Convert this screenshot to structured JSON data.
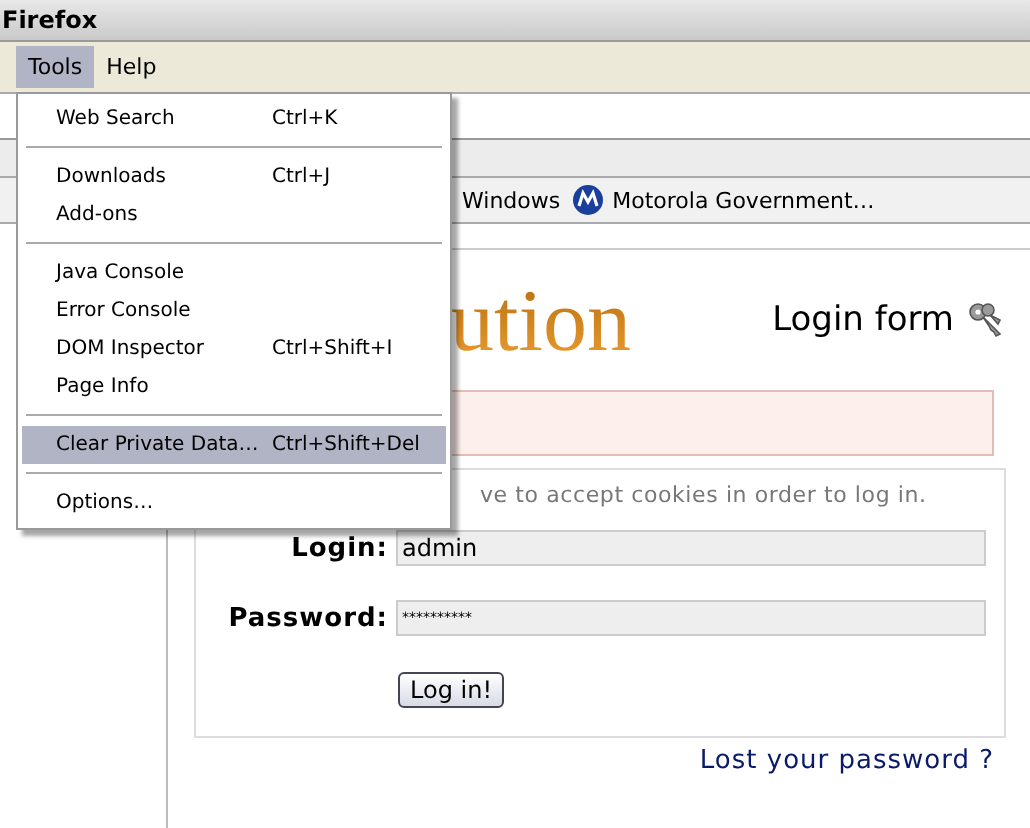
{
  "window": {
    "title": "Firefox"
  },
  "menubar": [
    {
      "label": "Tools",
      "selected": true
    },
    {
      "label": "Help",
      "selected": false
    }
  ],
  "bookmarks": [
    {
      "kind": "plain",
      "label": "Windows"
    },
    {
      "kind": "site",
      "label": "Motorola Government…"
    }
  ],
  "page": {
    "logo": "ution",
    "heading": "Login form",
    "cookies_note": "ve to accept cookies in order to log in.",
    "fields": [
      {
        "kind": "text",
        "label": "Login:",
        "value": "admin"
      },
      {
        "kind": "password",
        "label": "Password:",
        "value": "**********"
      }
    ],
    "submit": "Log in!",
    "link": "Lost your password ?"
  },
  "tools_menu": [
    {
      "kind": "item",
      "label": "Web Search",
      "shortcut": "Ctrl+K",
      "selected": false
    },
    {
      "kind": "separator"
    },
    {
      "kind": "item",
      "label": "Downloads",
      "shortcut": "Ctrl+J",
      "selected": false
    },
    {
      "kind": "item",
      "label": "Add-ons",
      "selected": false
    },
    {
      "kind": "separator"
    },
    {
      "kind": "item",
      "label": "Java Console",
      "selected": false
    },
    {
      "kind": "item",
      "label": "Error Console",
      "selected": false
    },
    {
      "kind": "item",
      "label": "DOM Inspector",
      "shortcut": "Ctrl+Shift+I",
      "selected": false
    },
    {
      "kind": "item",
      "label": "Page Info",
      "selected": false
    },
    {
      "kind": "separator"
    },
    {
      "kind": "item",
      "label": "Clear Private Data…",
      "shortcut": "Ctrl+Shift+Del",
      "selected": true
    },
    {
      "kind": "separator"
    },
    {
      "kind": "item",
      "label": "Options…",
      "selected": false
    }
  ]
}
